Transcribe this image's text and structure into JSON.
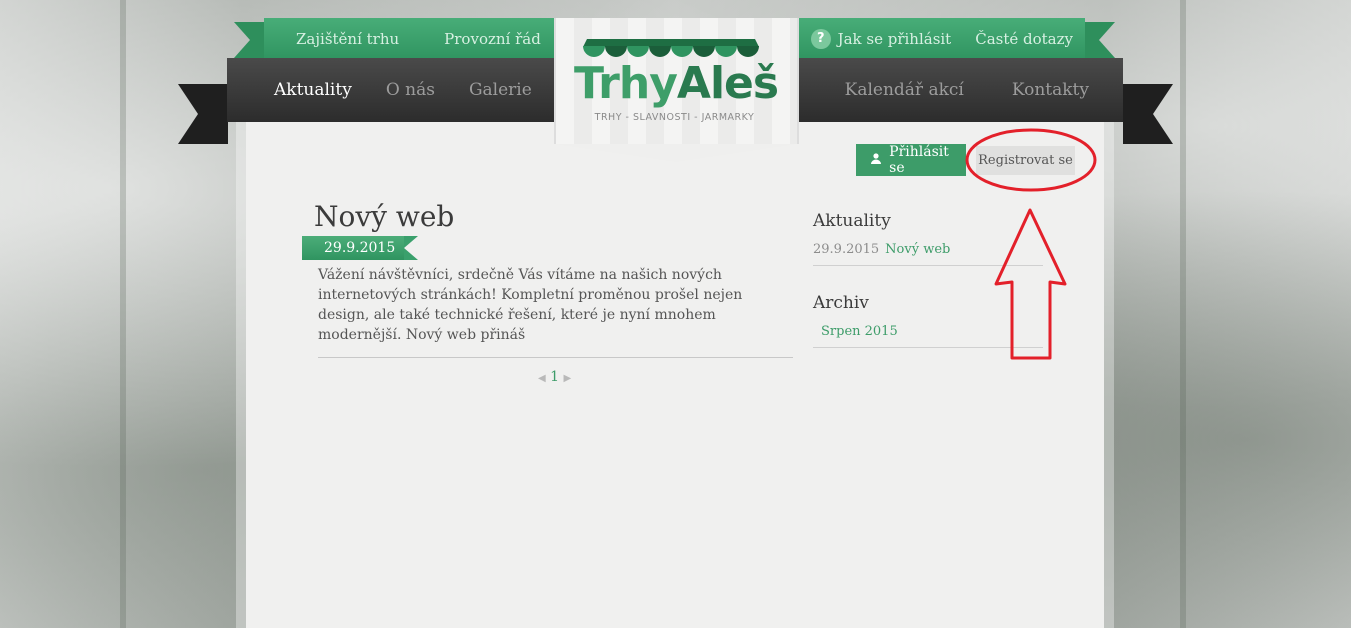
{
  "top_nav": {
    "left": [
      "Zajištění trhu",
      "Provozní řád"
    ],
    "help_label": "Jak se přihlásit",
    "faq_label": "Časté dotazy",
    "help_icon": "?"
  },
  "main_nav": {
    "left": [
      "Aktuality",
      "O nás",
      "Galerie"
    ],
    "right": [
      "Kalendář akcí",
      "Kontakty"
    ]
  },
  "logo": {
    "trhy": "Trhy",
    "ales": "Aleš",
    "subtitle": "TRHY - SLAVNOSTI - JARMARKY"
  },
  "auth": {
    "login_label": "Přihlásit se",
    "register_label": "Registrovat se"
  },
  "article": {
    "title": "Nový web",
    "date": "29.9.2015",
    "excerpt": "Vážení návštěvníci, srdečně Vás vítáme na našich nových internetových stránkách! Kompletní proměnou prošel nejen design, ale také technické řešení, které je nyní mnohem modernější. Nový web přináš"
  },
  "pagination": {
    "current": "1"
  },
  "sidebar": {
    "news_heading": "Aktuality",
    "news_date": "29.9.2015",
    "news_link": "Nový web",
    "archive_heading": "Archiv",
    "archive_link": "Srpen 2015"
  },
  "colors": {
    "green": "#3d9c69",
    "dark_nav": "#2c2c2c",
    "annotation_red": "#e3202a"
  }
}
